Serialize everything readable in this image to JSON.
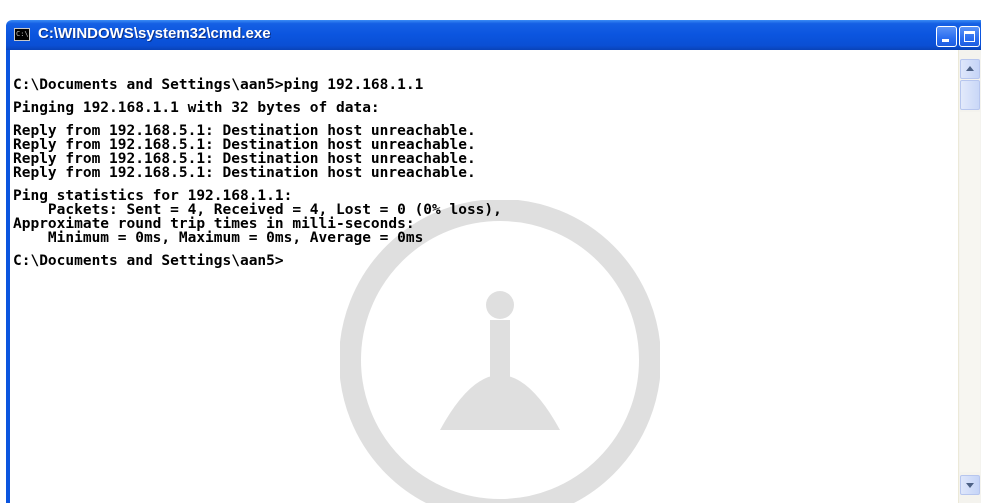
{
  "window": {
    "title": "C:\\WINDOWS\\system32\\cmd.exe",
    "icon": "cmd-console-icon",
    "icon_text": "C:\\",
    "titlebar_color": "#0b55df",
    "controls": {
      "minimize": "minimize-icon",
      "maximize": "maximize-icon",
      "close": "close-icon",
      "close_glyph": "×"
    }
  },
  "console": {
    "background": "#ffffff",
    "foreground": "#000000",
    "blocks": [
      [
        "C:\\Documents and Settings\\aan5>ping 192.168.1.1"
      ],
      [
        "Pinging 192.168.1.1 with 32 bytes of data:"
      ],
      [
        "Reply from 192.168.5.1: Destination host unreachable.",
        "Reply from 192.168.5.1: Destination host unreachable.",
        "Reply from 192.168.5.1: Destination host unreachable.",
        "Reply from 192.168.5.1: Destination host unreachable."
      ],
      [
        "Ping statistics for 192.168.1.1:",
        "    Packets: Sent = 4, Received = 4, Lost = 0 (0% loss),",
        "Approximate round trip times in milli-seconds:",
        "    Minimum = 0ms, Maximum = 0ms, Average = 0ms"
      ],
      [
        "C:\\Documents and Settings\\aan5>"
      ]
    ]
  },
  "scrollbar": {
    "up": "scroll-up-arrow-icon",
    "down": "scroll-down-arrow-icon"
  }
}
